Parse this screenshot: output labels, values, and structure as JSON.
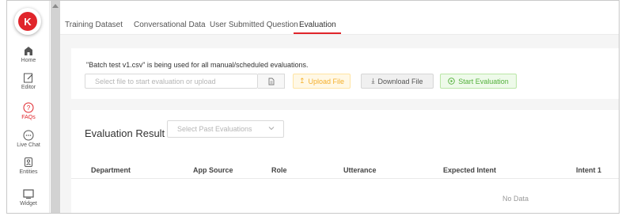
{
  "sidebar": {
    "logo_letter": "K",
    "items": [
      {
        "label": "Home",
        "icon": "home-icon"
      },
      {
        "label": "Editor",
        "icon": "editor-icon"
      },
      {
        "label": "FAQs",
        "icon": "faq-icon",
        "active": true
      },
      {
        "label": "Live Chat",
        "icon": "chat-icon"
      },
      {
        "label": "Entities",
        "icon": "entities-icon"
      },
      {
        "label": "Widget",
        "icon": "widget-icon"
      }
    ]
  },
  "tabs": [
    {
      "label": "Training Dataset"
    },
    {
      "label": "Conversational Data"
    },
    {
      "label": "User Submitted Question"
    },
    {
      "label": "Evaluation",
      "active": true
    }
  ],
  "evaluation": {
    "notice": "\"Batch test v1.csv\" is being used for all manual/scheduled evaluations.",
    "file_placeholder": "Select file to start evaluation or upload",
    "upload_label": "Upload File",
    "download_label": "Download File",
    "start_label": "Start Evaluation"
  },
  "results": {
    "title": "Evaluation Result",
    "select_placeholder": "Select Past Evaluations",
    "columns": [
      "Department",
      "App Source",
      "Role",
      "Utterance",
      "Expected Intent",
      "Intent 1"
    ],
    "empty_text": "No Data"
  },
  "colors": {
    "brand": "#e0252b",
    "upload": "#f5b02d",
    "start": "#52b03a"
  }
}
